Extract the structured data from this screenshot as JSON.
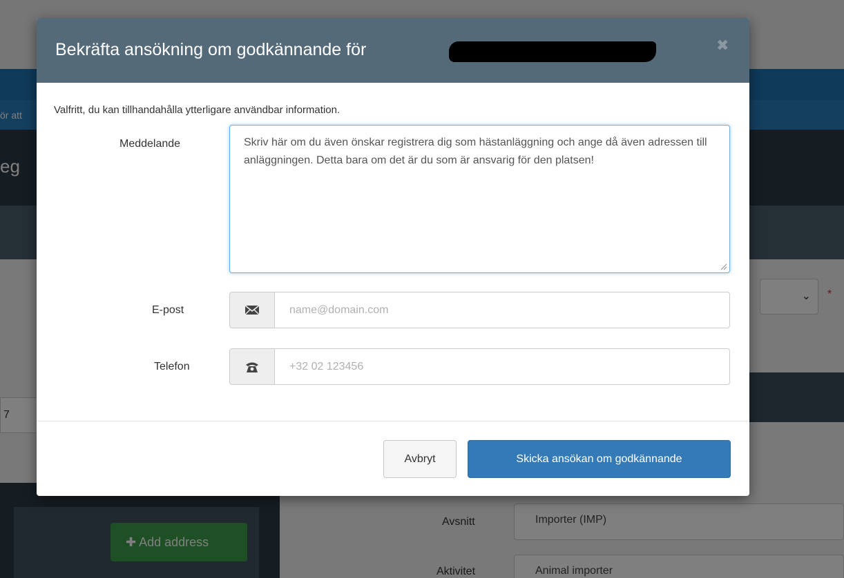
{
  "background": {
    "banner_text": "ör att",
    "heading_fragment": "eg",
    "field_fragment": "7",
    "add_address_label": "Add address",
    "select_chevron": "⌄",
    "required_mark": "*",
    "fields": [
      {
        "label": "Avsnitt",
        "value": "Importer (IMP)"
      },
      {
        "label": "Aktivitet",
        "value": "Animal importer"
      }
    ]
  },
  "modal": {
    "title": "Bekräfta ansökning om godkännande för",
    "close_glyph": "✖",
    "intro": "Valfritt, du kan tillhandahålla ytterligare användbar information.",
    "message": {
      "label": "Meddelande",
      "placeholder": "Skriv här om du även önskar registrera dig som hästanläggning och ange då även adressen till anläggningen. Detta bara om det är du som är ansvarig för den platsen!"
    },
    "email": {
      "label": "E-post",
      "placeholder": "name@domain.com"
    },
    "phone": {
      "label": "Telefon",
      "placeholder": "+32 02 123456"
    },
    "buttons": {
      "cancel": "Avbryt",
      "submit": "Skicka ansökan om godkännande"
    }
  }
}
